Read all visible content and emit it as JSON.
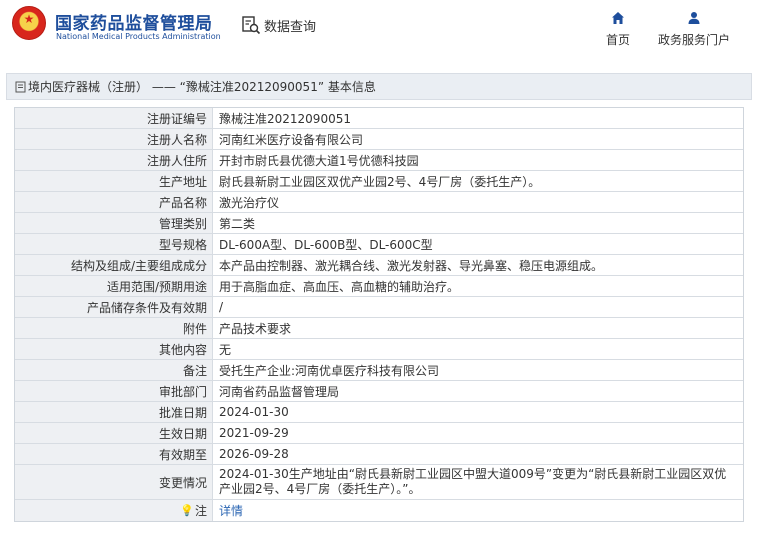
{
  "header": {
    "site_title_cn": "国家药品监督管理局",
    "site_title_en": "National Medical Products Administration",
    "query_label": "数据查询",
    "nav": [
      {
        "label": "首页",
        "icon": "home-icon"
      },
      {
        "label": "政务服务门户",
        "icon": "user-icon"
      }
    ]
  },
  "breadcrumb": "境内医疗器械（注册） —— “豫械注准20212090051” 基本信息",
  "rows": [
    {
      "label": "注册证编号",
      "value": "豫械注准20212090051"
    },
    {
      "label": "注册人名称",
      "value": "河南红米医疗设备有限公司"
    },
    {
      "label": "注册人住所",
      "value": "开封市尉氏县优德大道1号优德科技园"
    },
    {
      "label": "生产地址",
      "value": "尉氏县新尉工业园区双优产业园2号、4号厂房（委托生产）。"
    },
    {
      "label": "产品名称",
      "value": "激光治疗仪"
    },
    {
      "label": "管理类别",
      "value": "第二类"
    },
    {
      "label": "型号规格",
      "value": "DL-600A型、DL-600B型、DL-600C型"
    },
    {
      "label": "结构及组成/主要组成成分",
      "value": "本产品由控制器、激光耦合线、激光发射器、导光鼻塞、稳压电源组成。"
    },
    {
      "label": "适用范围/预期用途",
      "value": "用于高脂血症、高血压、高血糖的辅助治疗。"
    },
    {
      "label": "产品储存条件及有效期",
      "value": "/"
    },
    {
      "label": "附件",
      "value": "产品技术要求"
    },
    {
      "label": "其他内容",
      "value": "无"
    },
    {
      "label": "备注",
      "value": "受托生产企业:河南优卓医疗科技有限公司"
    },
    {
      "label": "审批部门",
      "value": "河南省药品监督管理局"
    },
    {
      "label": "批准日期",
      "value": "2024-01-30"
    },
    {
      "label": "生效日期",
      "value": "2021-09-29"
    },
    {
      "label": "有效期至",
      "value": "2026-09-28"
    },
    {
      "label": "变更情况",
      "value": "2024-01-30生产地址由“尉氏县新尉工业园区中盟大道009号”变更为“尉氏县新尉工业园区双优产业园2号、4号厂房（委托生产）。”。"
    }
  ],
  "note_row": {
    "label": "注",
    "link": "详情"
  },
  "colors": {
    "brand_blue": "#1e4e9c",
    "link_blue": "#2b66b3",
    "label_bg": "#eef0f3"
  }
}
